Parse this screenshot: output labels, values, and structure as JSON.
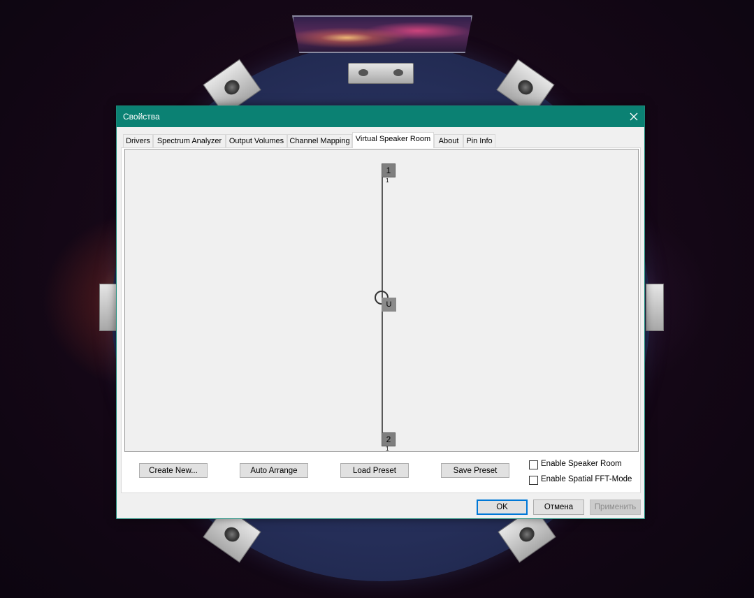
{
  "dialog": {
    "title": "Свойства"
  },
  "tabs": [
    {
      "label": "Drivers"
    },
    {
      "label": "Spectrum Analyzer"
    },
    {
      "label": "Output Volumes"
    },
    {
      "label": "Channel Mapping"
    },
    {
      "label": "Virtual Speaker Room",
      "active": true
    },
    {
      "label": "About"
    },
    {
      "label": "Pin Info"
    }
  ],
  "room": {
    "speakers": [
      {
        "label": "1",
        "sub": "1"
      },
      {
        "label": "2",
        "sub": "1"
      }
    ],
    "listener_label": "U"
  },
  "buttons": {
    "create_new": "Create New...",
    "auto_arrange": "Auto Arrange",
    "load_preset": "Load Preset",
    "save_preset": "Save Preset"
  },
  "checkboxes": {
    "enable_speaker_room": {
      "label": "Enable Speaker Room",
      "checked": false
    },
    "enable_spatial_fft": {
      "label": "Enable Spatial FFT-Mode",
      "checked": false
    }
  },
  "footer": {
    "ok": "OK",
    "cancel": "Отмена",
    "apply": "Применить"
  }
}
